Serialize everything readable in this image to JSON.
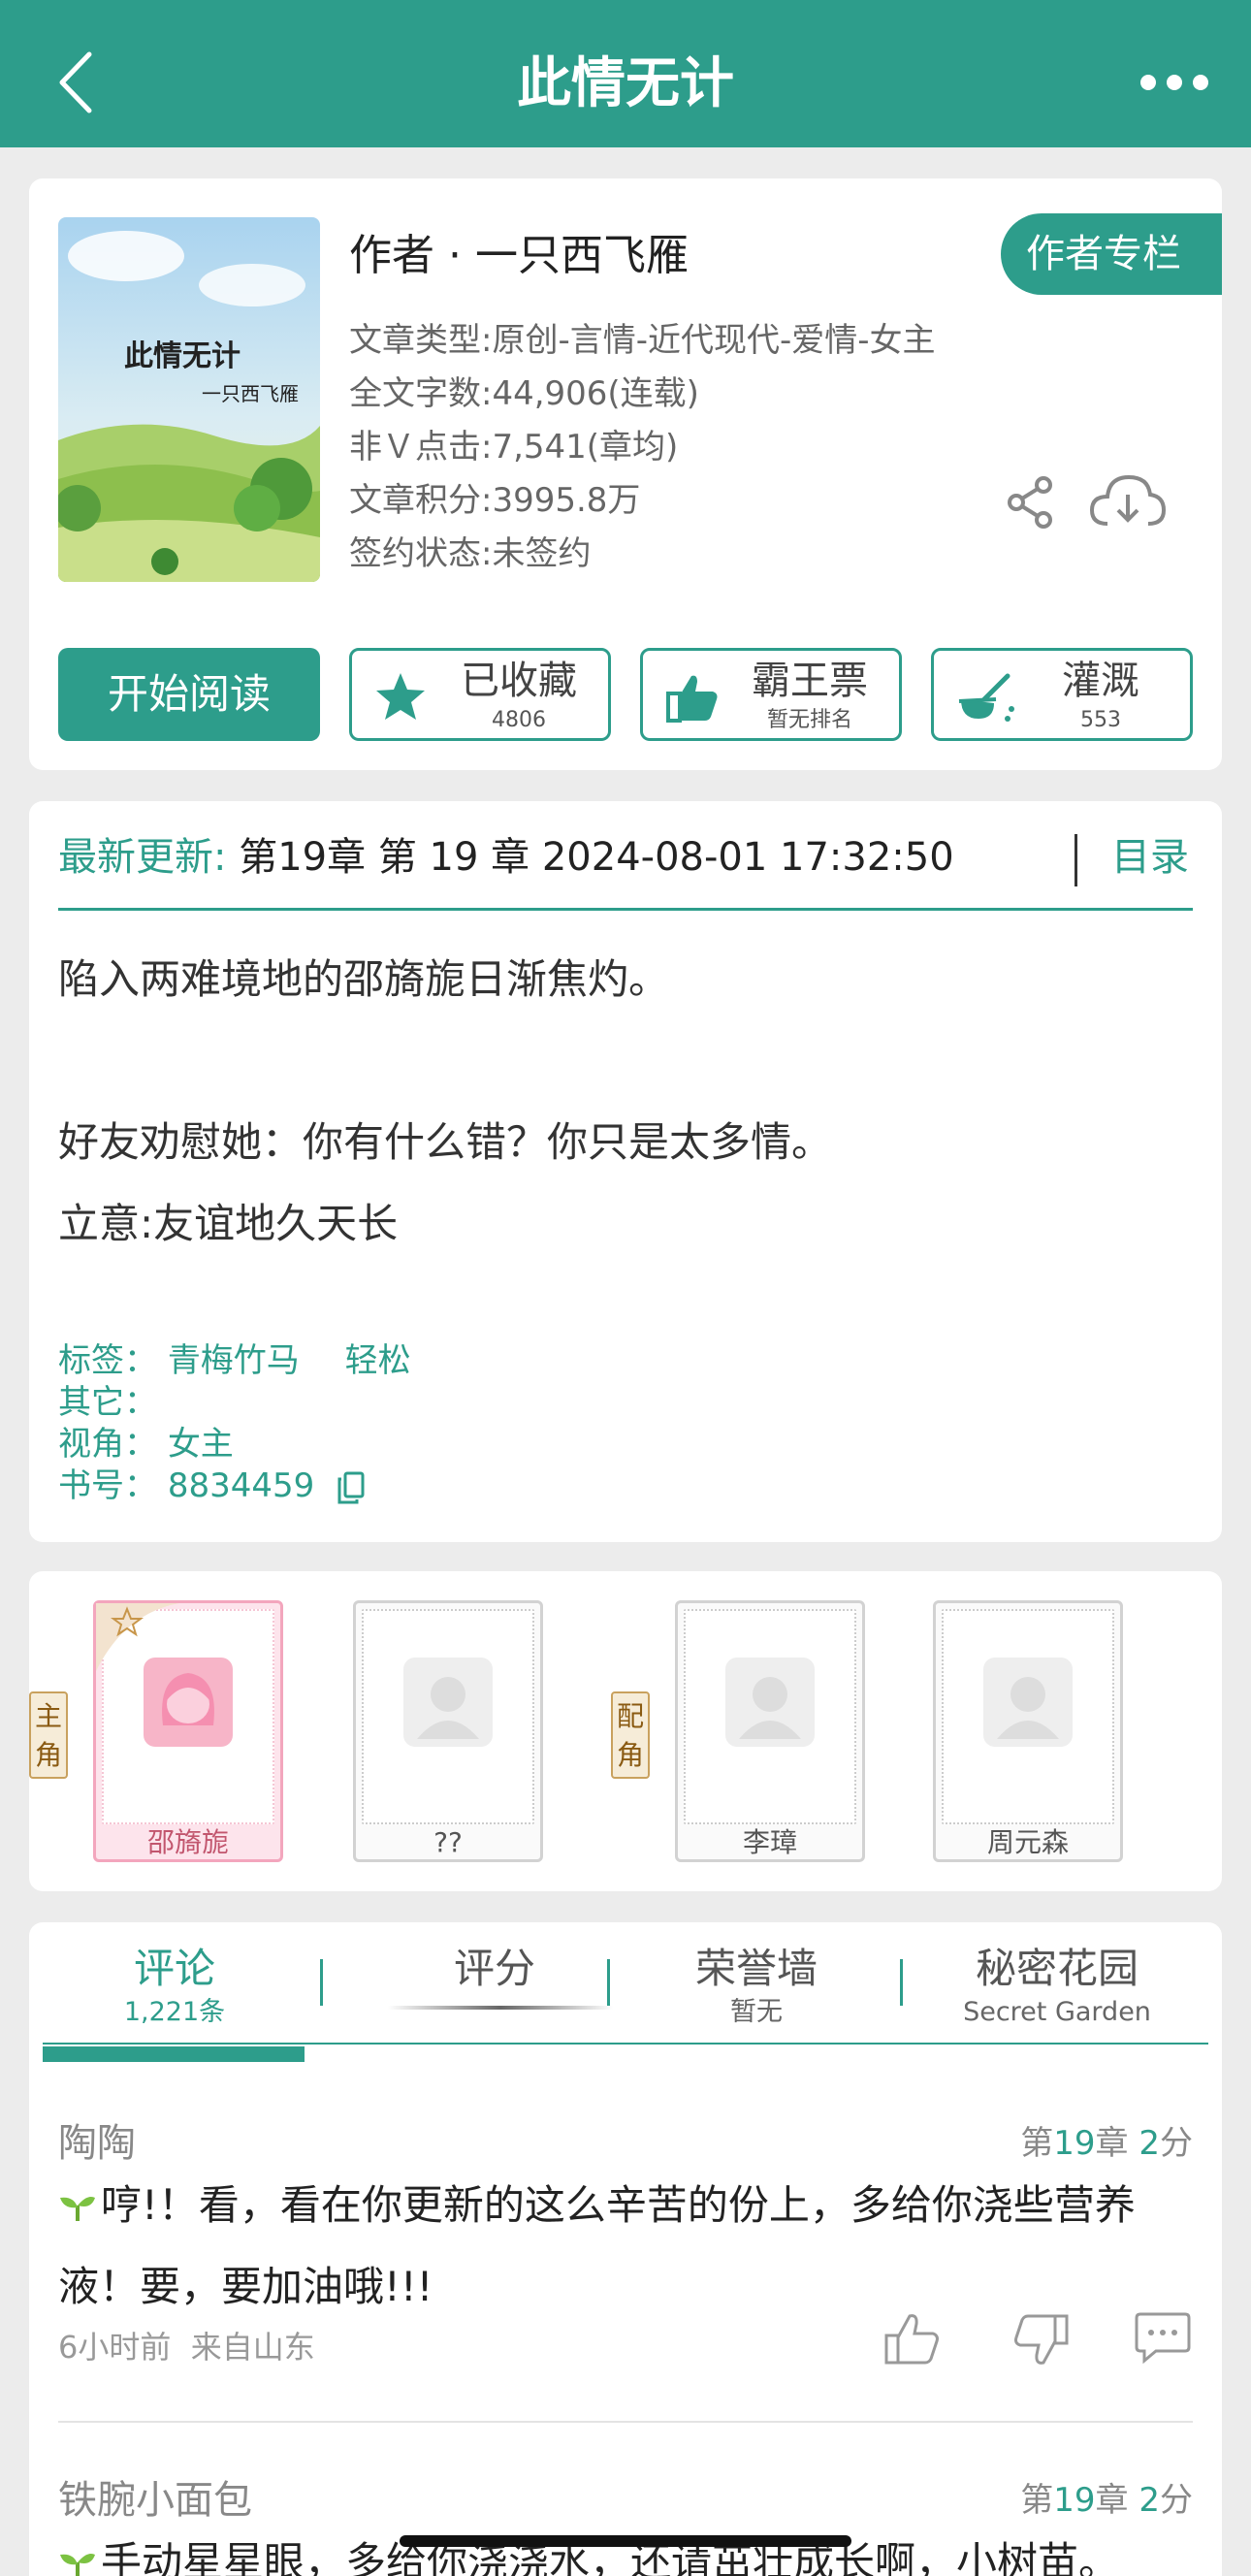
{
  "nav": {
    "title": "此情无计"
  },
  "book": {
    "cover_title": "此情无计",
    "cover_author": "一只西飞雁",
    "author_line": "作者 · 一只西飞雁",
    "author_column_label": "作者专栏",
    "meta": [
      "文章类型:原创-言情-近代现代-爱情-女主",
      "全文字数:44,906(连载)",
      "非Ｖ点击:7,541(章均)",
      "文章积分:3995.8万",
      "签约状态:未签约"
    ]
  },
  "actions": {
    "read_label": "开始阅读",
    "favorite": {
      "label": "已收藏",
      "count": "4806"
    },
    "bawang": {
      "label": "霸王票",
      "sub": "暂无排名"
    },
    "nutrient": {
      "label": "灌溉",
      "count": "553"
    }
  },
  "update": {
    "label": "最新更新:",
    "value": "第19章 第 19 章 2024-08-01 17:32:50",
    "toc_label": "目录"
  },
  "description": {
    "lines": [
      "陷入两难境地的邵旖旎日渐焦灼。",
      "",
      "好友劝慰她：你有什么错？你只是太多情。",
      "立意:友谊地久天长"
    ]
  },
  "tags": {
    "tags_label": "标签：",
    "tag1": "青梅竹马",
    "tag2": "轻松",
    "other_label": "其它：",
    "view_label": "视角：",
    "view_value": "女主",
    "id_label": "书号：",
    "id_value": "8834459"
  },
  "roles": {
    "main_label": "主角",
    "support_label": "配角",
    "main": [
      "邵旖旎",
      "??"
    ],
    "support": [
      "李璋",
      "周元森"
    ]
  },
  "tabs": [
    {
      "label": "评论",
      "sub": "1,221条"
    },
    {
      "label": "评分",
      "sub": ""
    },
    {
      "label": "荣誉墙",
      "sub": "暂无"
    },
    {
      "label": "秘密花园",
      "sub": "Secret Garden"
    }
  ],
  "comments": [
    {
      "user": "陶陶",
      "ch_prefix": "第",
      "ch_num": "19",
      "ch_mid": "章",
      "score": "2",
      "score_unit": "分",
      "text": "哼!！看，看在你更新的这么辛苦的份上，多给你浇些营养液！要，要加油哦!!!",
      "time": "6小时前",
      "location": "来自山东"
    },
    {
      "user": "铁腕小面包",
      "ch_prefix": "第",
      "ch_num": "19",
      "ch_mid": "章",
      "score": "2",
      "score_unit": "分",
      "text": "手动星星眼，多给你浇浇水，还请茁壮成长啊，小树苗。"
    }
  ],
  "colors": {
    "primary": "#2d9d8b",
    "background": "#ececec",
    "main_role": "#f7b5c8"
  }
}
